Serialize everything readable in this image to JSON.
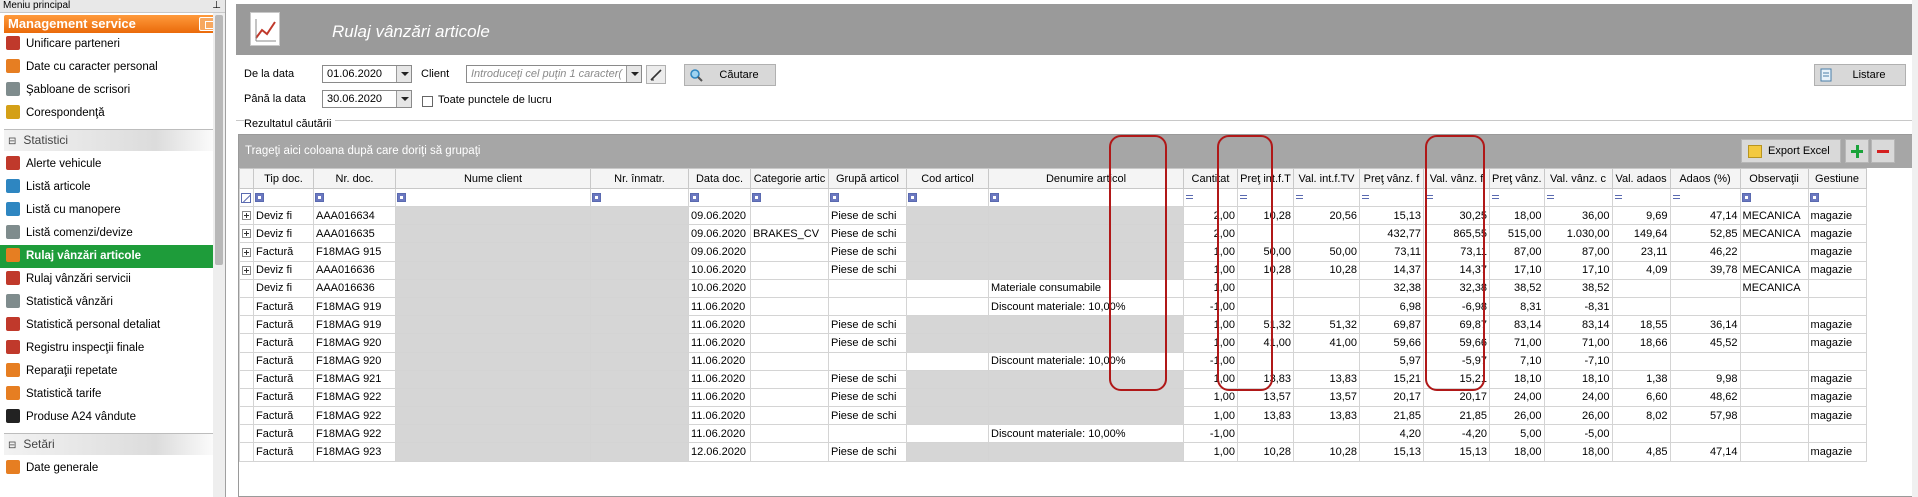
{
  "sidebar": {
    "top_label": "Meniu principal",
    "header": "Management service",
    "items_a": [
      {
        "label": "Unificare parteneri",
        "color": "#c0392b"
      },
      {
        "label": "Date cu caracter personal",
        "color": "#e67e22"
      },
      {
        "label": "Şabloane de scrisori",
        "color": "#7f8c8d"
      },
      {
        "label": "Corespondenţă",
        "color": "#d4a017"
      }
    ],
    "section_statistici": "Statistici",
    "items_b": [
      {
        "label": "Alerte vehicule",
        "color": "#c0392b"
      },
      {
        "label": "Listă articole",
        "color": "#2e86c1"
      },
      {
        "label": "Listă cu manopere",
        "color": "#2e86c1"
      },
      {
        "label": "Listă comenzi/devize",
        "color": "#7f8c8d"
      },
      {
        "label": "Rulaj vânzări articole",
        "color": "#e67e22",
        "active": true
      },
      {
        "label": "Rulaj vânzări servicii",
        "color": "#c0392b"
      },
      {
        "label": "Statistică vânzări",
        "color": "#7f8c8d"
      },
      {
        "label": "Statistică personal detaliat",
        "color": "#c0392b"
      },
      {
        "label": "Registru inspecţii finale",
        "color": "#c0392b"
      },
      {
        "label": "Reparaţii repetate",
        "color": "#e67e22"
      },
      {
        "label": "Statistică tarife",
        "color": "#e67e22"
      },
      {
        "label": "Produse A24 vândute",
        "color": "#222222"
      }
    ],
    "section_setari": "Setări",
    "items_c": [
      {
        "label": "Date generale",
        "color": "#e67e22"
      }
    ]
  },
  "page": {
    "title": "Rulaj vânzări articole"
  },
  "filters": {
    "from_label": "De la data",
    "from_value": "01.06.2020",
    "to_label": "Până la data",
    "to_value": "30.06.2020",
    "client_label": "Client",
    "client_placeholder": "Introduceţi cel puţin 1 caracter(",
    "search_label": "Căutare",
    "all_points_label": "Toate punctele de lucru",
    "list_label": "Listare",
    "results_label": "Rezultatul căutării"
  },
  "grid": {
    "group_hint": "Trageţi aici coloana după care doriţi să grupaţi",
    "export_label": "Export Excel",
    "columns": [
      "Tip doc.",
      "Nr. doc.",
      "Nume client",
      "Nr. înmatr.",
      "Data doc.",
      "Categorie artic",
      "Grupă articol",
      "Cod articol",
      "Denumire articol",
      "Cantitat",
      "Preţ int.f.T",
      "Val. int.f.TV",
      "Preţ vânz. f",
      "Val. vânz. f",
      "Preţ vânz.",
      "Val. vânz. c",
      "Val. adaos",
      "Adaos (%)",
      "Observaţii",
      "Gestiune"
    ],
    "rows": [
      {
        "exp": true,
        "tip": "Deviz fi",
        "nr": "AAA016634",
        "data": "09.06.2020",
        "cat": "",
        "grupa": "Piese de schi",
        "den": "",
        "cant": "2,00",
        "pit": "10,28",
        "vit": "20,56",
        "pvf": "15,13",
        "vvf": "30,25",
        "pv": "18,00",
        "vvc": "36,00",
        "va": "9,69",
        "ap": "47,14",
        "obs": "MECANICA",
        "gest": "magazie"
      },
      {
        "exp": true,
        "tip": "Deviz fi",
        "nr": "AAA016635",
        "data": "09.06.2020",
        "cat": "BRAKES_CV",
        "grupa": "Piese de schi",
        "den": "",
        "cant": "2,00",
        "pit": "",
        "vit": "",
        "pvf": "432,77",
        "vvf": "865,55",
        "pv": "515,00",
        "vvc": "1.030,00",
        "va": "149,64",
        "ap": "52,85",
        "obs": "MECANICA",
        "gest": "magazie"
      },
      {
        "exp": true,
        "tip": "Factură",
        "nr": "F18MAG 915",
        "data": "09.06.2020",
        "cat": "",
        "grupa": "Piese de schi",
        "den": "",
        "cant": "1,00",
        "pit": "50,00",
        "vit": "50,00",
        "pvf": "73,11",
        "vvf": "73,11",
        "pv": "87,00",
        "vvc": "87,00",
        "va": "23,11",
        "ap": "46,22",
        "obs": "",
        "gest": "magazie"
      },
      {
        "exp": true,
        "tip": "Deviz fi",
        "nr": "AAA016636",
        "data": "10.06.2020",
        "cat": "",
        "grupa": "Piese de schi",
        "den": "",
        "cant": "1,00",
        "pit": "10,28",
        "vit": "10,28",
        "pvf": "14,37",
        "vvf": "14,37",
        "pv": "17,10",
        "vvc": "17,10",
        "va": "4,09",
        "ap": "39,78",
        "obs": "MECANICA",
        "gest": "magazie"
      },
      {
        "exp": false,
        "tip": "Deviz fi",
        "nr": "AAA016636",
        "data": "10.06.2020",
        "cat": "",
        "grupa": "",
        "den": "Materiale consumabile",
        "cant": "1,00",
        "pit": "",
        "vit": "",
        "pvf": "32,38",
        "vvf": "32,38",
        "pv": "38,52",
        "vvc": "38,52",
        "va": "",
        "ap": "",
        "obs": "MECANICA",
        "gest": ""
      },
      {
        "exp": false,
        "tip": "Factură",
        "nr": "F18MAG 919",
        "data": "11.06.2020",
        "cat": "",
        "grupa": "",
        "den": "Discount materiale: 10,00%",
        "cant": "-1,00",
        "pit": "",
        "vit": "",
        "pvf": "6,98",
        "vvf": "-6,98",
        "pv": "8,31",
        "vvc": "-8,31",
        "va": "",
        "ap": "",
        "obs": "",
        "gest": ""
      },
      {
        "exp": false,
        "tip": "Factură",
        "nr": "F18MAG 919",
        "data": "11.06.2020",
        "cat": "",
        "grupa": "Piese de schi",
        "den": "",
        "cant": "1,00",
        "pit": "51,32",
        "vit": "51,32",
        "pvf": "69,87",
        "vvf": "69,87",
        "pv": "83,14",
        "vvc": "83,14",
        "va": "18,55",
        "ap": "36,14",
        "obs": "",
        "gest": "magazie"
      },
      {
        "exp": false,
        "tip": "Factură",
        "nr": "F18MAG 920",
        "data": "11.06.2020",
        "cat": "",
        "grupa": "Piese de schi",
        "den": "",
        "cant": "1,00",
        "pit": "41,00",
        "vit": "41,00",
        "pvf": "59,66",
        "vvf": "59,66",
        "pv": "71,00",
        "vvc": "71,00",
        "va": "18,66",
        "ap": "45,52",
        "obs": "",
        "gest": "magazie"
      },
      {
        "exp": false,
        "tip": "Factură",
        "nr": "F18MAG 920",
        "data": "11.06.2020",
        "cat": "",
        "grupa": "",
        "den": "Discount materiale: 10,00%",
        "cant": "-1,00",
        "pit": "",
        "vit": "",
        "pvf": "5,97",
        "vvf": "-5,97",
        "pv": "7,10",
        "vvc": "-7,10",
        "va": "",
        "ap": "",
        "obs": "",
        "gest": ""
      },
      {
        "exp": false,
        "tip": "Factură",
        "nr": "F18MAG 921",
        "data": "11.06.2020",
        "cat": "",
        "grupa": "Piese de schi",
        "den": "",
        "cant": "1,00",
        "pit": "13,83",
        "vit": "13,83",
        "pvf": "15,21",
        "vvf": "15,21",
        "pv": "18,10",
        "vvc": "18,10",
        "va": "1,38",
        "ap": "9,98",
        "obs": "",
        "gest": "magazie"
      },
      {
        "exp": false,
        "tip": "Factură",
        "nr": "F18MAG 922",
        "data": "11.06.2020",
        "cat": "",
        "grupa": "Piese de schi",
        "den": "",
        "cant": "1,00",
        "pit": "13,57",
        "vit": "13,57",
        "pvf": "20,17",
        "vvf": "20,17",
        "pv": "24,00",
        "vvc": "24,00",
        "va": "6,60",
        "ap": "48,62",
        "obs": "",
        "gest": "magazie"
      },
      {
        "exp": false,
        "tip": "Factură",
        "nr": "F18MAG 922",
        "data": "11.06.2020",
        "cat": "",
        "grupa": "Piese de schi",
        "den": "",
        "cant": "1,00",
        "pit": "13,83",
        "vit": "13,83",
        "pvf": "21,85",
        "vvf": "21,85",
        "pv": "26,00",
        "vvc": "26,00",
        "va": "8,02",
        "ap": "57,98",
        "obs": "",
        "gest": "magazie"
      },
      {
        "exp": false,
        "tip": "Factură",
        "nr": "F18MAG 922",
        "data": "11.06.2020",
        "cat": "",
        "grupa": "",
        "den": "Discount materiale: 10,00%",
        "cant": "-1,00",
        "pit": "",
        "vit": "",
        "pvf": "4,20",
        "vvf": "-4,20",
        "pv": "5,00",
        "vvc": "-5,00",
        "va": "",
        "ap": "",
        "obs": "",
        "gest": ""
      },
      {
        "exp": false,
        "tip": "Factură",
        "nr": "F18MAG 923",
        "data": "12.06.2020",
        "cat": "",
        "grupa": "Piese de schi",
        "den": "",
        "cant": "1,00",
        "pit": "10,28",
        "vit": "10,28",
        "pvf": "15,13",
        "vvf": "15,13",
        "pv": "18,00",
        "vvc": "18,00",
        "va": "4,85",
        "ap": "47,14",
        "obs": "",
        "gest": "magazie"
      }
    ]
  },
  "colors": {
    "brand_orange": "#ef7a1a",
    "active_green": "#1e9c3a",
    "highlight_red": "#b01818",
    "title_bar": "#9a9a9a"
  }
}
